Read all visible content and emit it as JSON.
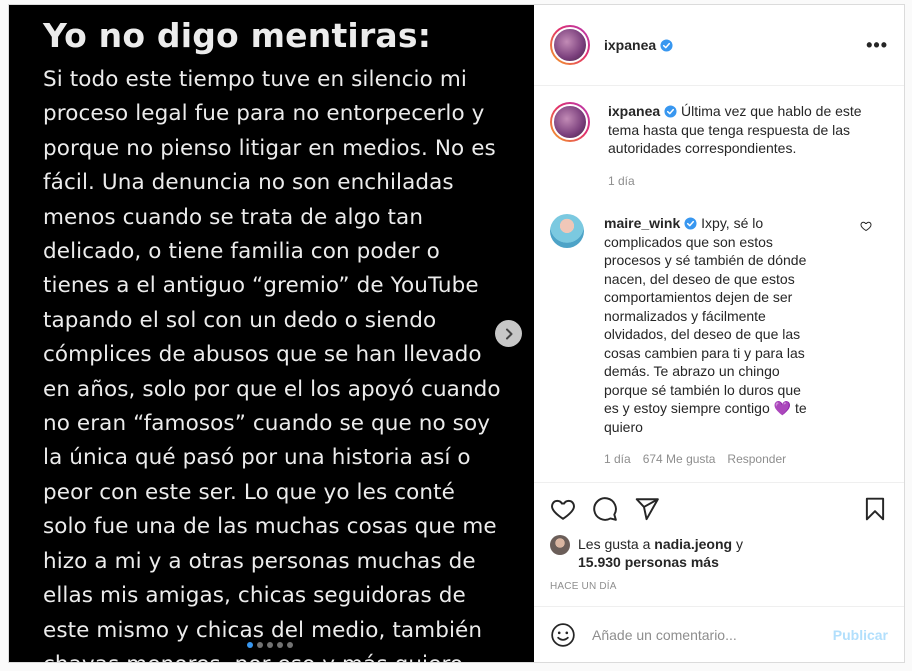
{
  "media": {
    "title": "Yo no digo mentiras:",
    "body": "Si todo este tiempo tuve en silencio mi\nproceso legal fue para no entorpecerlo y\nporque no pienso litigar en medios. No es\nfácil. Una denuncia no son enchiladas\nmenos cuando se trata de algo tan\ndelicado, o tiene familia con poder o\ntienes a el antiguo “gremio” de YouTube\ntapando el sol con un dedo o siendo\ncómplices de abusos  que se han llevado\nen años, solo por que el los apoyó cuando\nno eran “famosos” cuando se que no soy\nla única qué pasó por una historia así o\npeor con este ser.  Lo que yo les conté\nsolo fue una de las muchas cosas que me\nhizo a mi y a otras personas muchas de\nellas mis amigas, chicas seguidoras de\neste mismo y chicas del medio, también\nchavas menores, por eso y más quiero",
    "slide_count": 5,
    "active_slide": 1
  },
  "header": {
    "username": "ixpanea",
    "more_label": "•••"
  },
  "caption": {
    "username": "ixpanea",
    "text": "Última vez que hablo de este tema hasta que tenga respuesta de las autoridades correspondientes.",
    "time": "1 día"
  },
  "comment": {
    "username": "maire_wink",
    "text": "Ixpy, sé lo complicados que son estos procesos y sé también de dónde nacen, del deseo de que estos comportamientos dejen de ser normalizados y fácilmente olvidados, del deseo de que las cosas cambien para ti y para las demás. Te abrazo un chingo porque sé también lo duros que es y estoy siempre contigo",
    "emoji": "💜",
    "text_end": "te quiero",
    "time": "1 día",
    "likes": "674 Me gusta",
    "reply": "Responder"
  },
  "likes": {
    "prefix": "Les gusta a",
    "user": "nadia.jeong",
    "joiner": "y",
    "others": "15.930 personas más"
  },
  "timestamp": "HACE UN DÍA",
  "add_comment": {
    "placeholder": "Añade un comentario...",
    "publish": "Publicar"
  },
  "colors": {
    "accent": "#3897f0",
    "publish_disabled": "#b2dffc",
    "verified": "#3897f0"
  }
}
